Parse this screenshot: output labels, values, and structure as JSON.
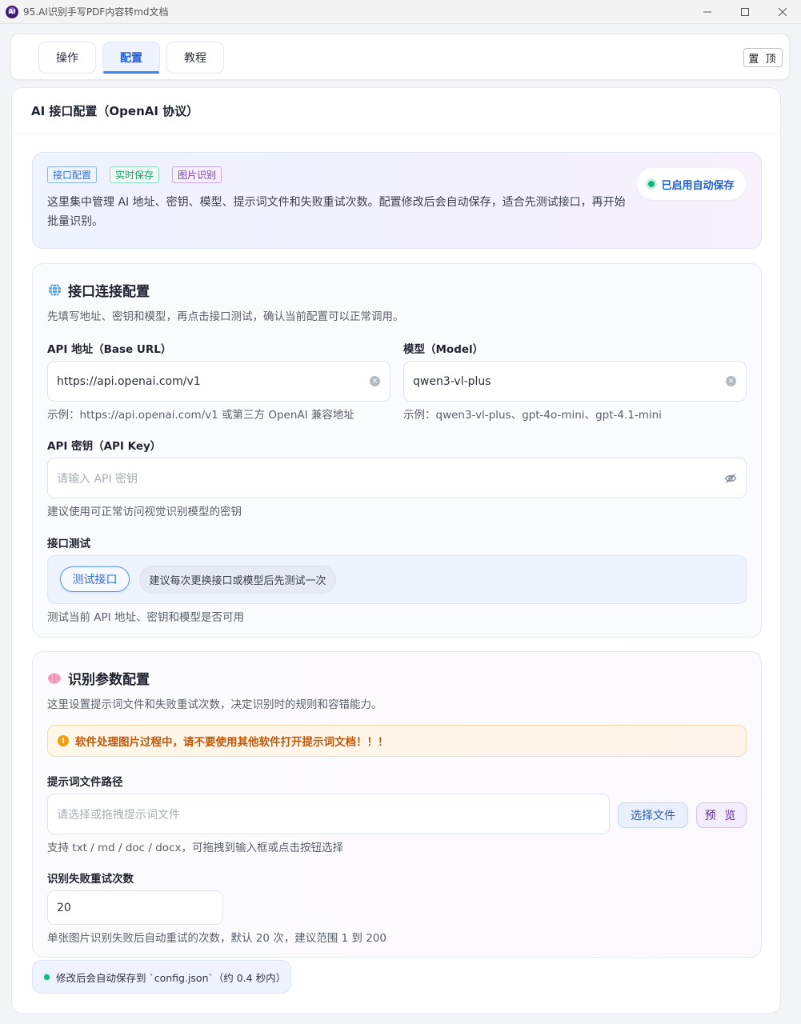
{
  "window": {
    "title": "95.AI识别手写PDF内容转md文档"
  },
  "tabs": [
    {
      "label": "操作",
      "active": false
    },
    {
      "label": "配置",
      "active": true
    },
    {
      "label": "教程",
      "active": false
    }
  ],
  "pin_label": "置 顶",
  "page_title": "AI 接口配置（OpenAI 协议）",
  "intro": {
    "badges": [
      "接口配置",
      "实时保存",
      "图片识别"
    ],
    "description": "这里集中管理 AI 地址、密钥、模型、提示词文件和失败重试次数。配置修改后会自动保存，适合先测试接口，再开始批量识别。",
    "autosave_label": "已启用自动保存"
  },
  "connection": {
    "title": "接口连接配置",
    "description": "先填写地址、密钥和模型，再点击接口测试，确认当前配置可以正常调用。",
    "api_url": {
      "label": "API 地址（Base URL）",
      "value": "https://api.openai.com/v1",
      "hint": "示例：https://api.openai.com/v1 或第三方 OpenAI 兼容地址"
    },
    "model": {
      "label": "模型（Model）",
      "value": "qwen3-vl-plus",
      "hint": "示例：qwen3-vl-plus、gpt-4o-mini、gpt-4.1-mini"
    },
    "api_key": {
      "label": "API 密钥（API Key）",
      "placeholder": "请输入 API 密钥",
      "hint": "建议使用可正常访问视觉识别模型的密钥"
    },
    "test": {
      "label": "接口测试",
      "button": "测试接口",
      "tip": "建议每次更换接口或模型后先测试一次",
      "hint": "测试当前 API 地址、密钥和模型是否可用"
    }
  },
  "recognition": {
    "title": "识别参数配置",
    "description": "这里设置提示词文件和失败重试次数，决定识别时的规则和容错能力。",
    "warning": "软件处理图片过程中，请不要使用其他软件打开提示词文档！！！",
    "prompt_file": {
      "label": "提示词文件路径",
      "placeholder": "请选择或拖拽提示词文件",
      "select_button": "选择文件",
      "preview_button": "预 览",
      "hint": "支持 txt / md / doc / docx，可拖拽到输入框或点击按钮选择"
    },
    "retry": {
      "label": "识别失败重试次数",
      "value": "20",
      "hint": "单张图片识别失败后自动重试的次数，默认 20 次，建议范围 1 到 200"
    }
  },
  "footer_note": "修改后会自动保存到 `config.json`（约 0.4 秒内）",
  "colors": {
    "accent": "#3b82f6",
    "success": "#10b981",
    "warning": "#c2580a"
  }
}
